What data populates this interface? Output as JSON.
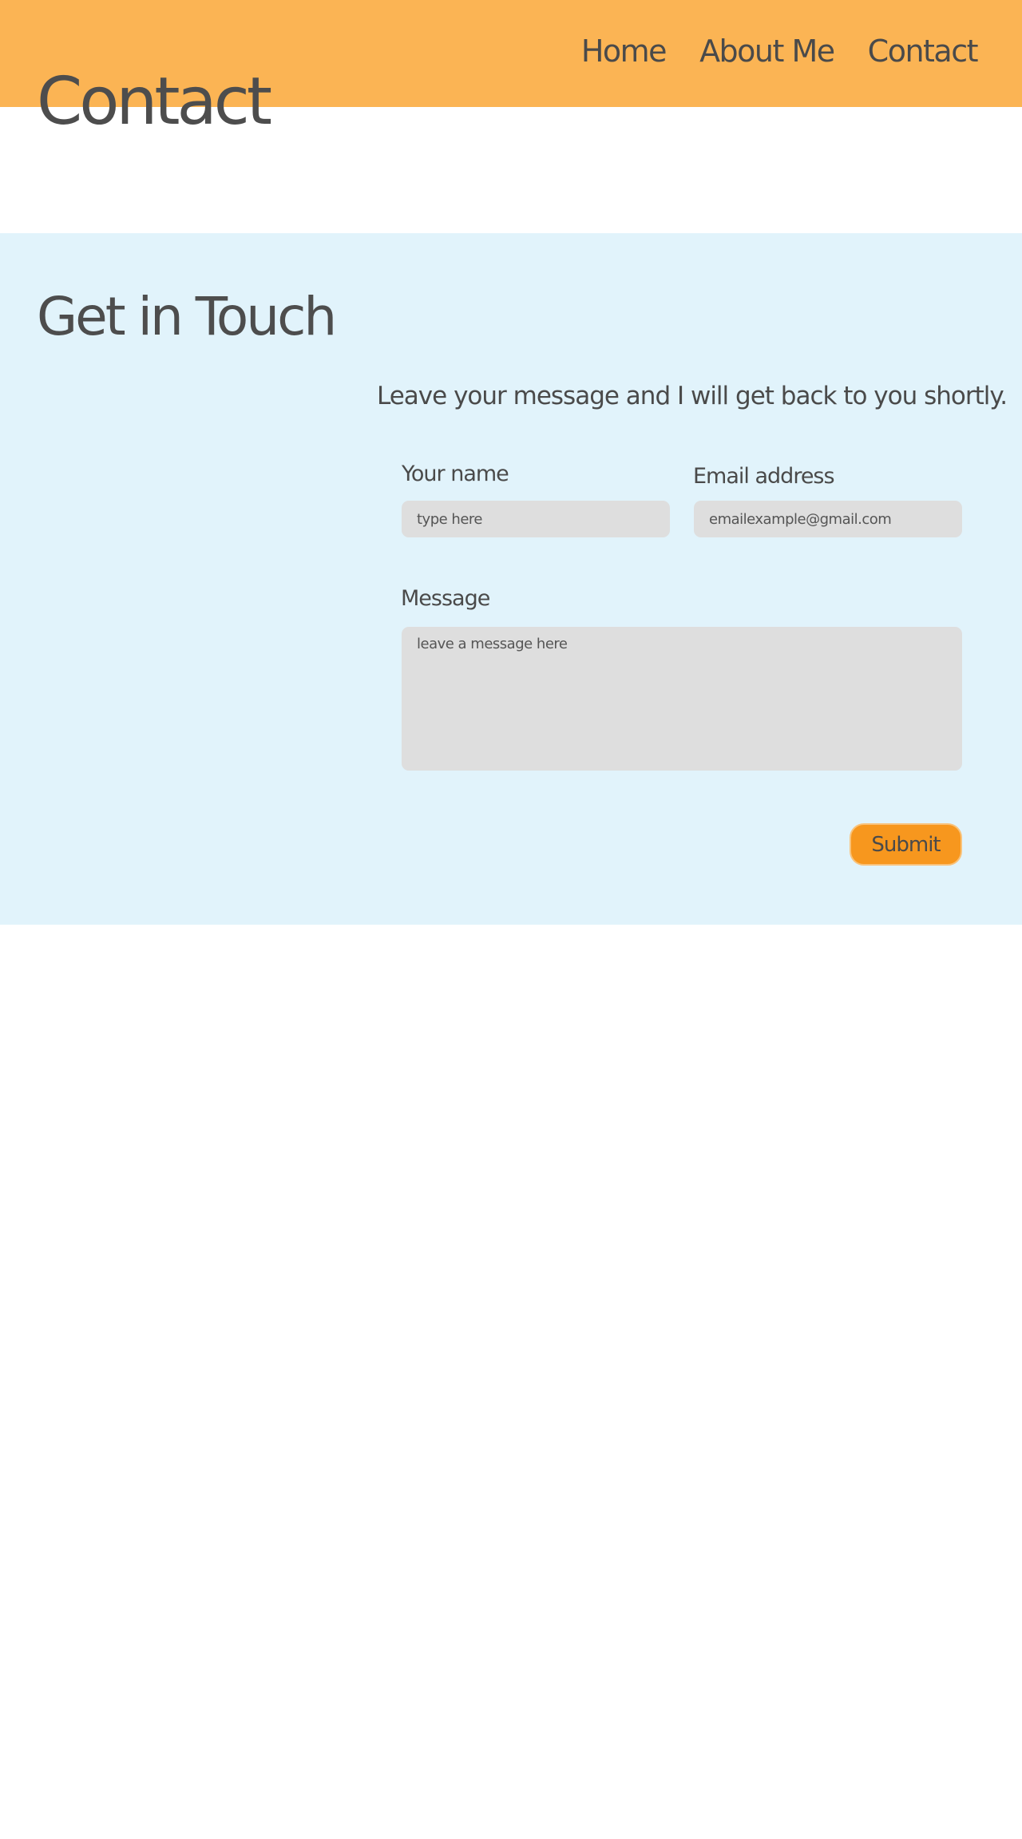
{
  "header": {
    "nav": [
      {
        "label": "Home"
      },
      {
        "label": "About Me"
      },
      {
        "label": "Contact"
      }
    ],
    "page_title": "Contact",
    "background_color": "#fbb454"
  },
  "contact": {
    "heading": "Get in Touch",
    "intro": "Leave your message and I will get back to you shortly.",
    "background_color": "#e1f3fb",
    "form": {
      "name_label": "Your name",
      "name_placeholder": "type here",
      "email_label": "Email address",
      "email_placeholder": "emailexample@gmail.com",
      "message_label": "Message",
      "message_placeholder": "leave a message here",
      "submit_label": "Submit",
      "submit_color": "#f7971e"
    }
  }
}
